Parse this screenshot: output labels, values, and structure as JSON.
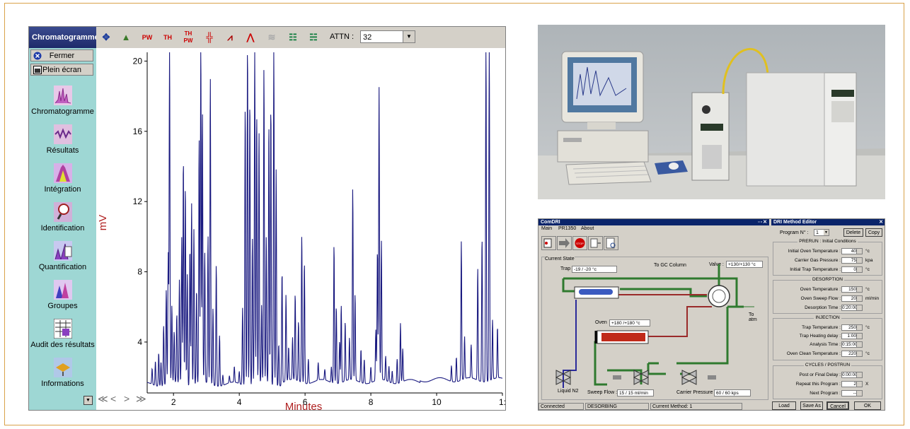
{
  "chromatogram": {
    "title": "Chromatogramme",
    "attn_label": "ATTN :",
    "attn_value": "32",
    "toolbar_icons": [
      "move-icon",
      "peak-icon",
      "pw-icon",
      "th-icon",
      "th-pw-icon",
      "add-baseline-icon",
      "manual-integrate-icon",
      "curve-icon",
      "overlay-icon",
      "compare-icon",
      "report-icon"
    ],
    "close_label": "Fermer",
    "fullscreen_label": "Plein écran",
    "nav": [
      {
        "label": "Chromatogramme",
        "icon": "chromatogram-icon"
      },
      {
        "label": "Résultats",
        "icon": "results-icon"
      },
      {
        "label": "Intégration",
        "icon": "integration-icon"
      },
      {
        "label": "Identification",
        "icon": "identification-icon"
      },
      {
        "label": "Quantification",
        "icon": "quantification-icon"
      },
      {
        "label": "Groupes",
        "icon": "groups-icon"
      },
      {
        "label": "Audit des résultats",
        "icon": "audit-icon"
      },
      {
        "label": "Informations",
        "icon": "information-icon"
      }
    ],
    "arrows": [
      "≪",
      "<",
      ">",
      "≫"
    ]
  },
  "chart_data": {
    "type": "line",
    "xlabel": "Minutes",
    "ylabel": "mV",
    "xlim": [
      1.2,
      12
    ],
    "ylim": [
      1.1,
      20.5
    ],
    "xticks": [
      "2",
      "4",
      "6",
      "8",
      "10",
      "1:"
    ],
    "yticks": [
      "4",
      "8",
      "12",
      "16",
      "20"
    ],
    "baseline": 1.6,
    "grid": false,
    "series_color": "#1a1a80",
    "peaks": [
      [
        1.35,
        2.5
      ],
      [
        1.45,
        3.0
      ],
      [
        1.55,
        3.5
      ],
      [
        1.62,
        3.0
      ],
      [
        1.7,
        5.0
      ],
      [
        1.78,
        7.0
      ],
      [
        1.84,
        9.0
      ],
      [
        1.88,
        21.0
      ],
      [
        1.95,
        6.0
      ],
      [
        2.02,
        4.5
      ],
      [
        2.1,
        5.5
      ],
      [
        2.18,
        7.5
      ],
      [
        2.25,
        10.0
      ],
      [
        2.3,
        14.5
      ],
      [
        2.36,
        13.0
      ],
      [
        2.42,
        8.0
      ],
      [
        2.5,
        9.5
      ],
      [
        2.55,
        12.0
      ],
      [
        2.62,
        10.5
      ],
      [
        2.7,
        7.0
      ],
      [
        2.78,
        15.5
      ],
      [
        2.83,
        21.0
      ],
      [
        2.88,
        17.0
      ],
      [
        2.95,
        9.0
      ],
      [
        3.05,
        10.0
      ],
      [
        3.12,
        19.0
      ],
      [
        3.2,
        6.0
      ],
      [
        3.3,
        8.5
      ],
      [
        3.4,
        4.5
      ],
      [
        3.5,
        2.2
      ],
      [
        3.7,
        2.0
      ],
      [
        3.85,
        2.5
      ],
      [
        4.0,
        2.3
      ],
      [
        4.1,
        6.0
      ],
      [
        4.18,
        17.5
      ],
      [
        4.25,
        21.0
      ],
      [
        4.32,
        18.0
      ],
      [
        4.4,
        10.0
      ],
      [
        4.47,
        21.0
      ],
      [
        4.53,
        17.0
      ],
      [
        4.6,
        16.0
      ],
      [
        4.68,
        6.0
      ],
      [
        4.75,
        19.5
      ],
      [
        4.82,
        10.0
      ],
      [
        4.9,
        16.5
      ],
      [
        4.96,
        17.5
      ],
      [
        5.05,
        21.0
      ],
      [
        5.12,
        14.0
      ],
      [
        5.2,
        4.0
      ],
      [
        5.3,
        8.0
      ],
      [
        5.42,
        6.5
      ],
      [
        5.5,
        3.5
      ],
      [
        5.62,
        4.0
      ],
      [
        5.7,
        6.5
      ],
      [
        5.8,
        5.0
      ],
      [
        5.9,
        10.0
      ],
      [
        5.98,
        8.5
      ],
      [
        6.1,
        3.0
      ],
      [
        6.4,
        2.6
      ],
      [
        6.6,
        2.2
      ],
      [
        6.8,
        2.5
      ],
      [
        6.88,
        9.5
      ],
      [
        6.95,
        6.0
      ],
      [
        7.05,
        4.0
      ],
      [
        7.1,
        6.0
      ],
      [
        7.22,
        5.0
      ],
      [
        7.35,
        4.0
      ],
      [
        7.45,
        12.5
      ],
      [
        7.52,
        6.5
      ],
      [
        7.7,
        3.5
      ],
      [
        7.8,
        3.0
      ],
      [
        8.0,
        2.5
      ],
      [
        8.15,
        4.5
      ],
      [
        8.2,
        9.0
      ],
      [
        8.25,
        18.3
      ],
      [
        8.32,
        9.5
      ],
      [
        8.45,
        3.0
      ],
      [
        8.55,
        2.5
      ],
      [
        8.65,
        2.3
      ],
      [
        8.8,
        3.0
      ],
      [
        8.9,
        5.0
      ],
      [
        8.97,
        3.5
      ],
      [
        10.45,
        2.5
      ],
      [
        10.6,
        3.0
      ],
      [
        10.75,
        9.5
      ],
      [
        10.85,
        4.0
      ],
      [
        11.05,
        3.5
      ],
      [
        11.25,
        8.0
      ],
      [
        11.38,
        9.8
      ],
      [
        11.5,
        20.5
      ],
      [
        11.6,
        21.0
      ],
      [
        11.7,
        5.0
      ],
      [
        11.85,
        4.5
      ]
    ]
  },
  "comdri": {
    "title": "ComDRI",
    "menu": [
      "Main",
      "PR1350",
      "About"
    ],
    "current_state_label": "Current State",
    "trap_label": "Trap",
    "trap_value": "-19 / -20 °c",
    "to_gc_label": "To GC Column",
    "valve_label": "Valve :",
    "valve_value": "+130/+130 °c",
    "oven_label": "Oven",
    "oven_value": "+180 /+180 °c",
    "to_atm_label": "To\natm",
    "liquid_label": "Liquid N2",
    "sweep_label": "Sweep Flow :",
    "sweep_value": "15 / 15 ml/min",
    "carrier_label": "Carrier Pressure :",
    "carrier_value": "60 / 60 kps",
    "status": [
      "Connected",
      "DESORBING",
      "Current Method: 1"
    ]
  },
  "editor": {
    "title": "DRI Method Editor",
    "program_label": "Program N° :",
    "program_value": "1",
    "delete_label": "Delete",
    "copy_label": "Copy",
    "groups": [
      {
        "title": "PRERUN : Initial Conditions",
        "rows": [
          {
            "label": "Initial Oven Temperature :",
            "value": "40",
            "unit": "°c"
          },
          {
            "label": "Carrier Gas Pressure :",
            "value": "75",
            "unit": "kpa"
          },
          {
            "label": "Initial Trap Temperature :",
            "value": "0",
            "unit": "°c"
          }
        ]
      },
      {
        "title": "DESORPTION",
        "rows": [
          {
            "label": "Oven Temperature :",
            "value": "150",
            "unit": "°c"
          },
          {
            "label": "Oven Sweep Flow :",
            "value": "20",
            "unit": "ml/min"
          },
          {
            "label": "Desorption Time :",
            "value": "0:20:00",
            "unit": ""
          }
        ]
      },
      {
        "title": "INJECTION",
        "rows": [
          {
            "label": "Trap Temperature :",
            "value": "250",
            "unit": "°c"
          },
          {
            "label": "Trap Heating delay :",
            "value": "1:00",
            "unit": ""
          },
          {
            "label": "Analysis Time :",
            "value": "0:15:00",
            "unit": ""
          },
          {
            "label": "Oven Clean Temperature :",
            "value": "220",
            "unit": "°c"
          }
        ]
      },
      {
        "title": "CYCLES / POSTRUN",
        "rows": [
          {
            "label": "Post or Final Delay :",
            "value": "0:00:00",
            "unit": ""
          },
          {
            "label": "Repeat this Program :",
            "value": "2",
            "unit": "X"
          },
          {
            "label": "Next Program :",
            "value": "--",
            "unit": ""
          }
        ]
      }
    ],
    "buttons": [
      "Load From",
      "Save As",
      "Cancel",
      "OK"
    ]
  }
}
